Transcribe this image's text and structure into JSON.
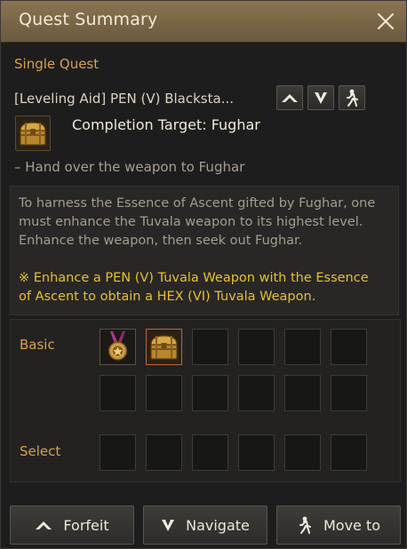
{
  "window": {
    "title": "Quest Summary"
  },
  "quest": {
    "type": "Single Quest",
    "name": "[Leveling Aid] PEN (V) Blacksta...",
    "completion_target": "Completion Target: Fughar",
    "objective": "– Hand over the weapon to Fughar",
    "description_lines": [
      "To harness the Essence of Ascent gifted by Fughar, one",
      "must enhance the Tuvala weapon to its highest level.",
      "Enhance the weapon, then seek out Fughar."
    ],
    "note_lines": [
      "※ Enhance a PEN (V) Tuvala Weapon with the Essence",
      "of Ascent to obtain a HEX (VI) Tuvala Weapon."
    ]
  },
  "rewards": {
    "basic_label": "Basic",
    "select_label": "Select",
    "basic_items": [
      "medal-icon",
      "treasure-chest-icon"
    ]
  },
  "buttons": {
    "forfeit": "Forfeit",
    "navigate": "Navigate",
    "move_to": "Move to"
  },
  "colors": {
    "title_bar": "#7a6546",
    "accent_gold": "#d9a14a",
    "note_yellow": "#e8c028",
    "chest_highlight": "#b56a40"
  }
}
